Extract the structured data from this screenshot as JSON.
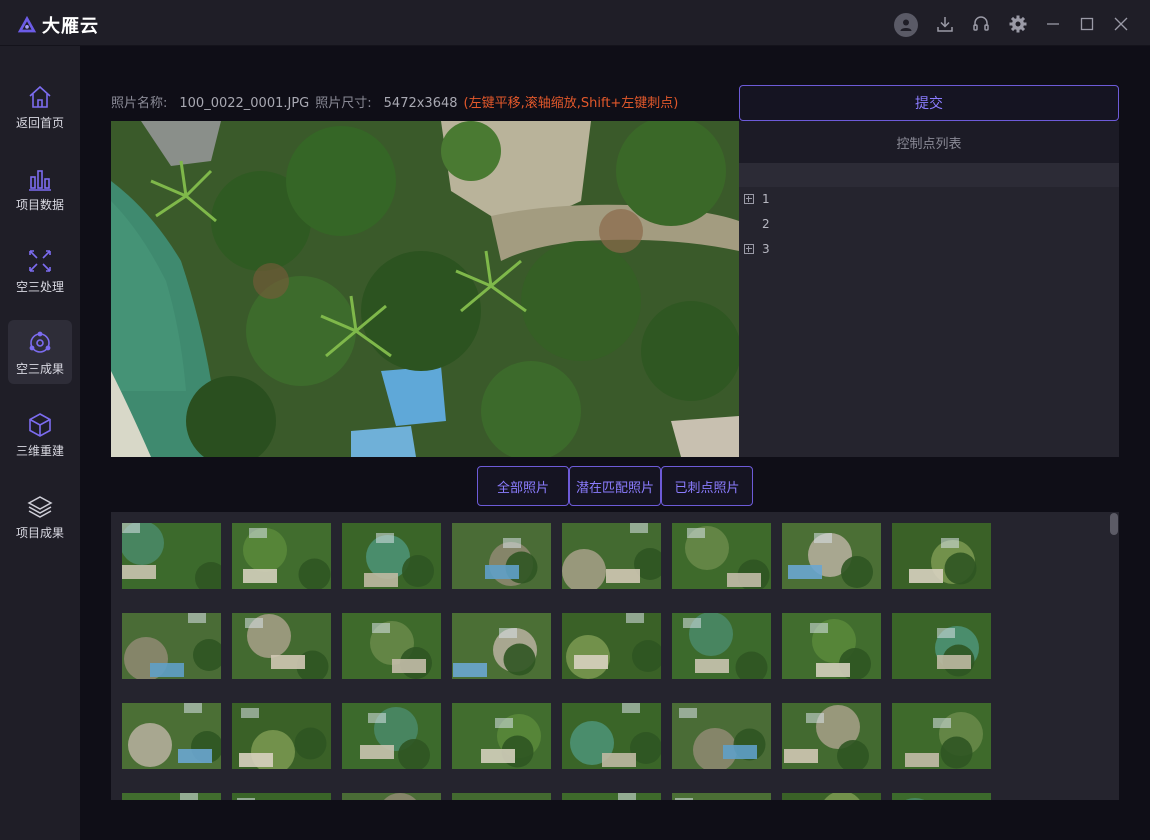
{
  "app": {
    "name": "大雁云"
  },
  "titlebar_icons": [
    "user-avatar-icon",
    "download-icon",
    "headset-icon",
    "gear-icon",
    "minimize-icon",
    "maximize-icon",
    "close-icon"
  ],
  "sidebar": {
    "items": [
      {
        "label": "返回首页",
        "icon": "home-icon"
      },
      {
        "label": "项目数据",
        "icon": "bar-chart-icon"
      },
      {
        "label": "空三处理",
        "icon": "aerotriangulation-icon"
      },
      {
        "label": "空三成果",
        "icon": "network-result-icon",
        "active": true
      },
      {
        "label": "三维重建",
        "icon": "cube-icon"
      },
      {
        "label": "项目成果",
        "icon": "layers-icon"
      }
    ]
  },
  "photo_info": {
    "name_label": "照片名称:",
    "name_value": "100_0022_0001.JPG",
    "size_label": "照片尺寸:",
    "size_value": "5472x3648",
    "hint": "(左键平移,滚轴缩放,Shift+左键刺点)"
  },
  "submit_label": "提交",
  "control_points": {
    "title": "控制点列表",
    "rows": [
      {
        "label": "1",
        "expandable": true
      },
      {
        "label": "2",
        "expandable": false
      },
      {
        "label": "3",
        "expandable": true
      }
    ]
  },
  "filters": {
    "all": "全部照片",
    "potential": "潜在匹配照片",
    "marked": "已刺点照片"
  },
  "colors": {
    "accent": "#6d5bd8",
    "accent_text": "#8b7cff",
    "hint": "#e2582b",
    "panel": "#25242e",
    "background": "#0f0e17"
  }
}
